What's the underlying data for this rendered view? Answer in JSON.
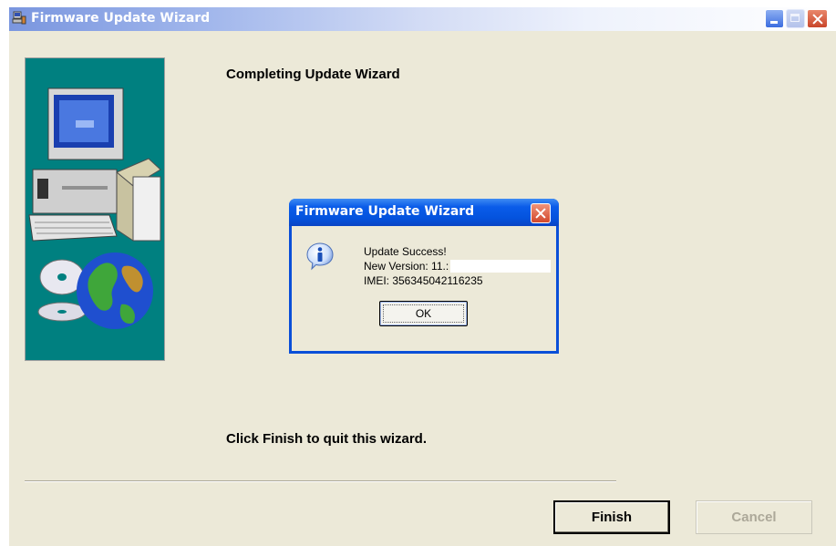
{
  "window": {
    "title": "Firmware Update Wizard"
  },
  "wizard": {
    "heading": "Completing Update Wizard",
    "footer_text": "Click Finish to quit this wizard.",
    "finish_label": "Finish",
    "cancel_label": "Cancel"
  },
  "dialog": {
    "title": "Firmware Update Wizard",
    "icon": "info-icon",
    "line1": "Update Success!",
    "line2": "New Version: 11.:",
    "line3": "IMEI: 356345042116235",
    "ok_label": "OK"
  },
  "colors": {
    "title_bar": "#7a96df",
    "dialog_title": "#0a5ce9",
    "close_button": "#d2482c",
    "panel": "#008080",
    "window_bg": "#ece9d8"
  }
}
